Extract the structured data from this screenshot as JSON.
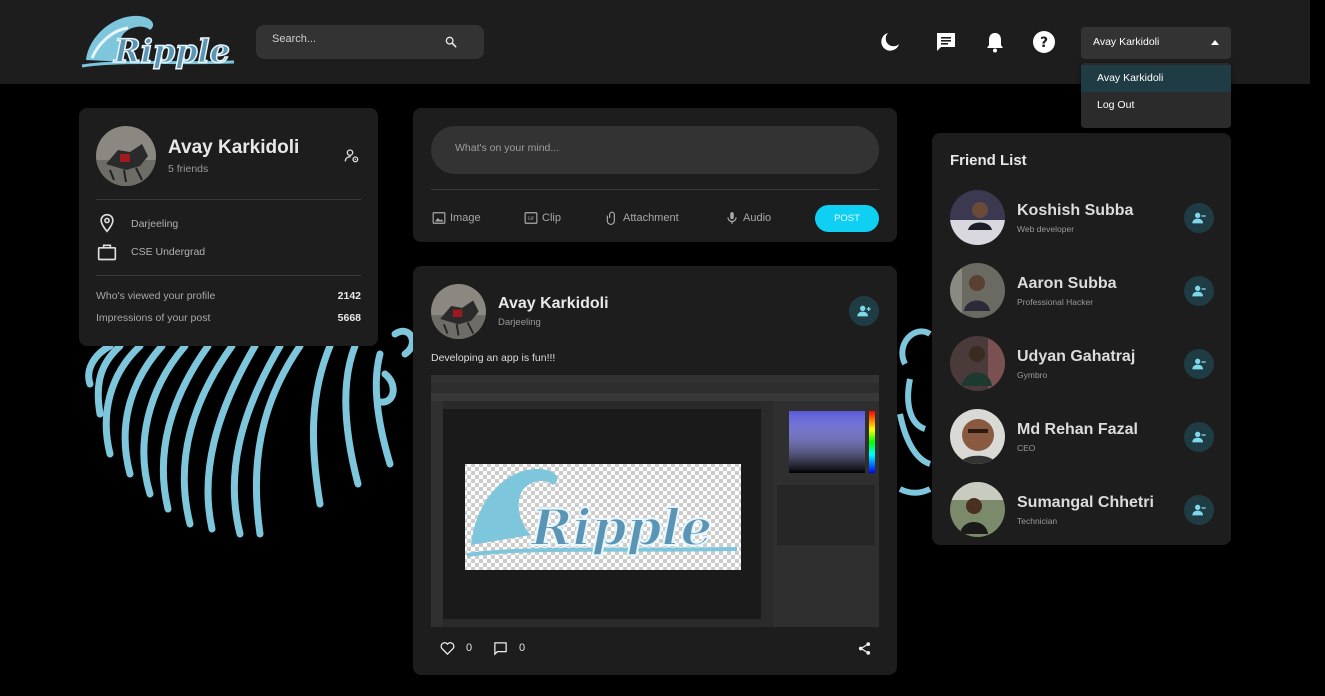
{
  "app": {
    "logo_text": "Ripple"
  },
  "header": {
    "search_placeholder": "Search...",
    "icons": [
      "moon-icon",
      "chat-icon",
      "bell-icon",
      "help-icon"
    ],
    "user_selected": "Avay Karkidoli",
    "dropdown": [
      "Avay Karkidoli",
      "Log Out"
    ]
  },
  "profile": {
    "name": "Avay Karkidoli",
    "friends": "5 friends",
    "location": "Darjeeling",
    "occupation": "CSE Undergrad",
    "stats": [
      {
        "label": "Who's viewed your profile",
        "value": "2142"
      },
      {
        "label": "Impressions of your post",
        "value": "5668"
      }
    ]
  },
  "composer": {
    "placeholder": "What's on your mind...",
    "options": [
      "Image",
      "Clip",
      "Attachment",
      "Audio"
    ],
    "post_label": "POST"
  },
  "post": {
    "author": "Avay Karkidoli",
    "location": "Darjeeling",
    "text": "Developing an app is fun!!!",
    "likes": "0",
    "comments": "0"
  },
  "friend_list": {
    "title": "Friend List",
    "friends": [
      {
        "name": "Koshish Subba",
        "role": "Web developer"
      },
      {
        "name": "Aaron Subba",
        "role": "Professional Hacker"
      },
      {
        "name": "Udyan Gahatraj",
        "role": "Gymbro"
      },
      {
        "name": "Md Rehan Fazal",
        "role": "CEO"
      },
      {
        "name": "Sumangal Chhetri",
        "role": "Technician"
      }
    ]
  },
  "colors": {
    "accent": "#0fd0f3",
    "card": "#1d1d1d",
    "wave": "#7dc6dc",
    "button_bg": "#1f3c44"
  }
}
